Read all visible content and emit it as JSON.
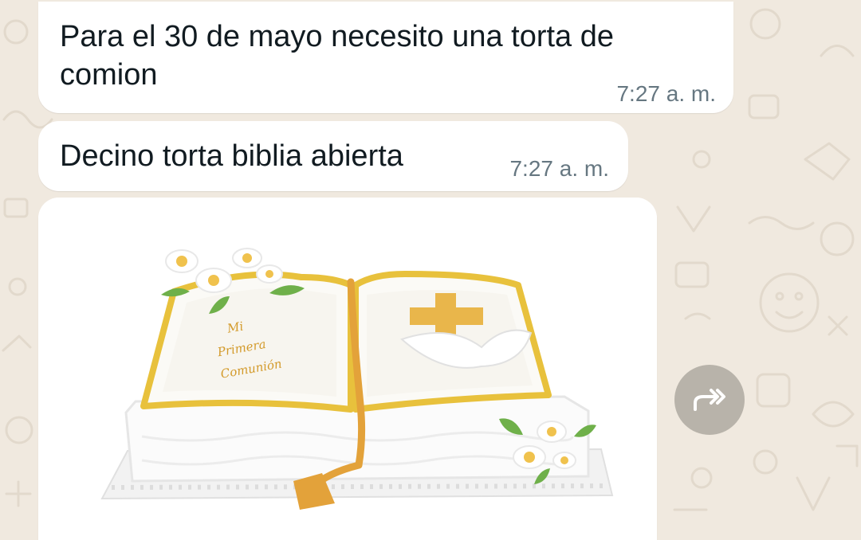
{
  "chat": {
    "messages": [
      {
        "text": "Para el 30 de mayo necesito una torta de\ncomion",
        "time": "7:27 a. m."
      },
      {
        "text": "Decino torta biblia abierta",
        "time": "7:27 a. m."
      },
      {
        "type": "image",
        "image_alt": "open bible cake",
        "cake_inscription": "Mi Primera Comunión"
      }
    ]
  },
  "icons": {
    "forward": "forward-icon"
  },
  "colors": {
    "wallpaper": "#f0e9df",
    "bubble": "#ffffff",
    "text": "#111b21",
    "timestamp": "#667781",
    "forward_button": "#b8b3aa"
  }
}
